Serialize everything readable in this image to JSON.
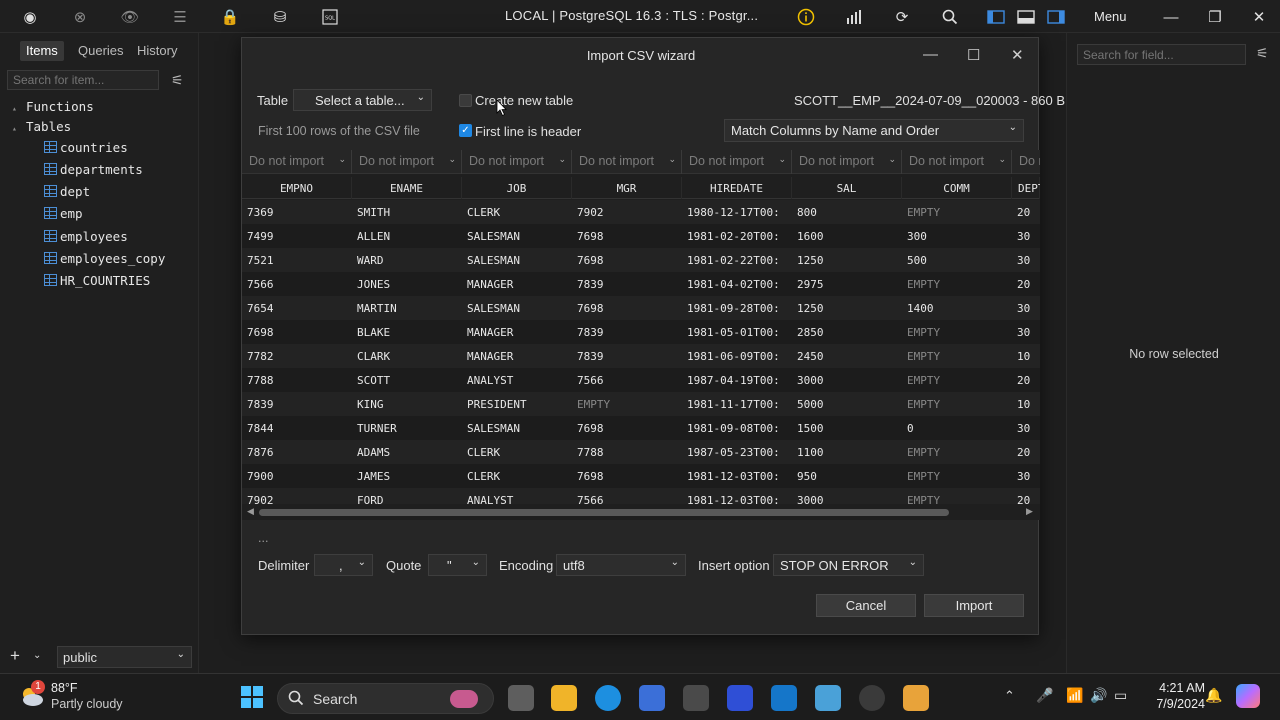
{
  "topbar": {
    "connection_title": "LOCAL | PostgreSQL 16.3 : TLS : Postgr...",
    "menu_label": "Menu"
  },
  "sidebar": {
    "tabs": [
      "Items",
      "Queries",
      "History"
    ],
    "search_placeholder": "Search for item...",
    "groups": [
      "Functions",
      "Tables"
    ],
    "tables": [
      "countries",
      "departments",
      "dept",
      "emp",
      "employees",
      "employees_copy",
      "HR_COUNTRIES"
    ],
    "add_label": "+",
    "schema": "public"
  },
  "right_panel": {
    "search_placeholder": "Search for field...",
    "empty_text": "No row selected"
  },
  "dialog": {
    "title": "Import CSV wizard",
    "table_label": "Table",
    "table_select": "Select a table...",
    "create_new_table": "Create new table",
    "create_new_table_checked": false,
    "file_info": "SCOTT__EMP__2024-07-09__020003 - 860 B",
    "preview_note": "First 100 rows of the CSV file",
    "first_line_header": "First line is header",
    "first_line_header_checked": true,
    "match_mode": "Match Columns by Name and Order",
    "import_placeholder": "Do not import",
    "columns": [
      "EMPNO",
      "ENAME",
      "JOB",
      "MGR",
      "HIREDATE",
      "SAL",
      "COMM",
      "DEPTNO"
    ],
    "rows": [
      [
        "7369",
        "SMITH",
        "CLERK",
        "7902",
        "1980-12-17T00:",
        "800",
        "EMPTY",
        "20"
      ],
      [
        "7499",
        "ALLEN",
        "SALESMAN",
        "7698",
        "1981-02-20T00:",
        "1600",
        "300",
        "30"
      ],
      [
        "7521",
        "WARD",
        "SALESMAN",
        "7698",
        "1981-02-22T00:",
        "1250",
        "500",
        "30"
      ],
      [
        "7566",
        "JONES",
        "MANAGER",
        "7839",
        "1981-04-02T00:",
        "2975",
        "EMPTY",
        "20"
      ],
      [
        "7654",
        "MARTIN",
        "SALESMAN",
        "7698",
        "1981-09-28T00:",
        "1250",
        "1400",
        "30"
      ],
      [
        "7698",
        "BLAKE",
        "MANAGER",
        "7839",
        "1981-05-01T00:",
        "2850",
        "EMPTY",
        "30"
      ],
      [
        "7782",
        "CLARK",
        "MANAGER",
        "7839",
        "1981-06-09T00:",
        "2450",
        "EMPTY",
        "10"
      ],
      [
        "7788",
        "SCOTT",
        "ANALYST",
        "7566",
        "1987-04-19T00:",
        "3000",
        "EMPTY",
        "20"
      ],
      [
        "7839",
        "KING",
        "PRESIDENT",
        "EMPTY",
        "1981-11-17T00:",
        "5000",
        "EMPTY",
        "10"
      ],
      [
        "7844",
        "TURNER",
        "SALESMAN",
        "7698",
        "1981-09-08T00:",
        "1500",
        "0",
        "30"
      ],
      [
        "7876",
        "ADAMS",
        "CLERK",
        "7788",
        "1987-05-23T00:",
        "1100",
        "EMPTY",
        "20"
      ],
      [
        "7900",
        "JAMES",
        "CLERK",
        "7698",
        "1981-12-03T00:",
        "950",
        "EMPTY",
        "30"
      ],
      [
        "7902",
        "FORD",
        "ANALYST",
        "7566",
        "1981-12-03T00:",
        "3000",
        "EMPTY",
        "20"
      ]
    ],
    "ellipsis": "...",
    "delimiter_label": "Delimiter",
    "delimiter_value": ",",
    "quote_label": "Quote",
    "quote_value": "\"",
    "encoding_label": "Encoding",
    "encoding_value": "utf8",
    "insert_option_label": "Insert option",
    "insert_option_value": "STOP ON ERROR",
    "cancel_label": "Cancel",
    "import_label": "Import"
  },
  "taskbar": {
    "weather_temp": "88°F",
    "weather_desc": "Partly cloudy",
    "weather_badge": "1",
    "search_label": "Search",
    "time": "4:21 AM",
    "date": "7/9/2024"
  }
}
